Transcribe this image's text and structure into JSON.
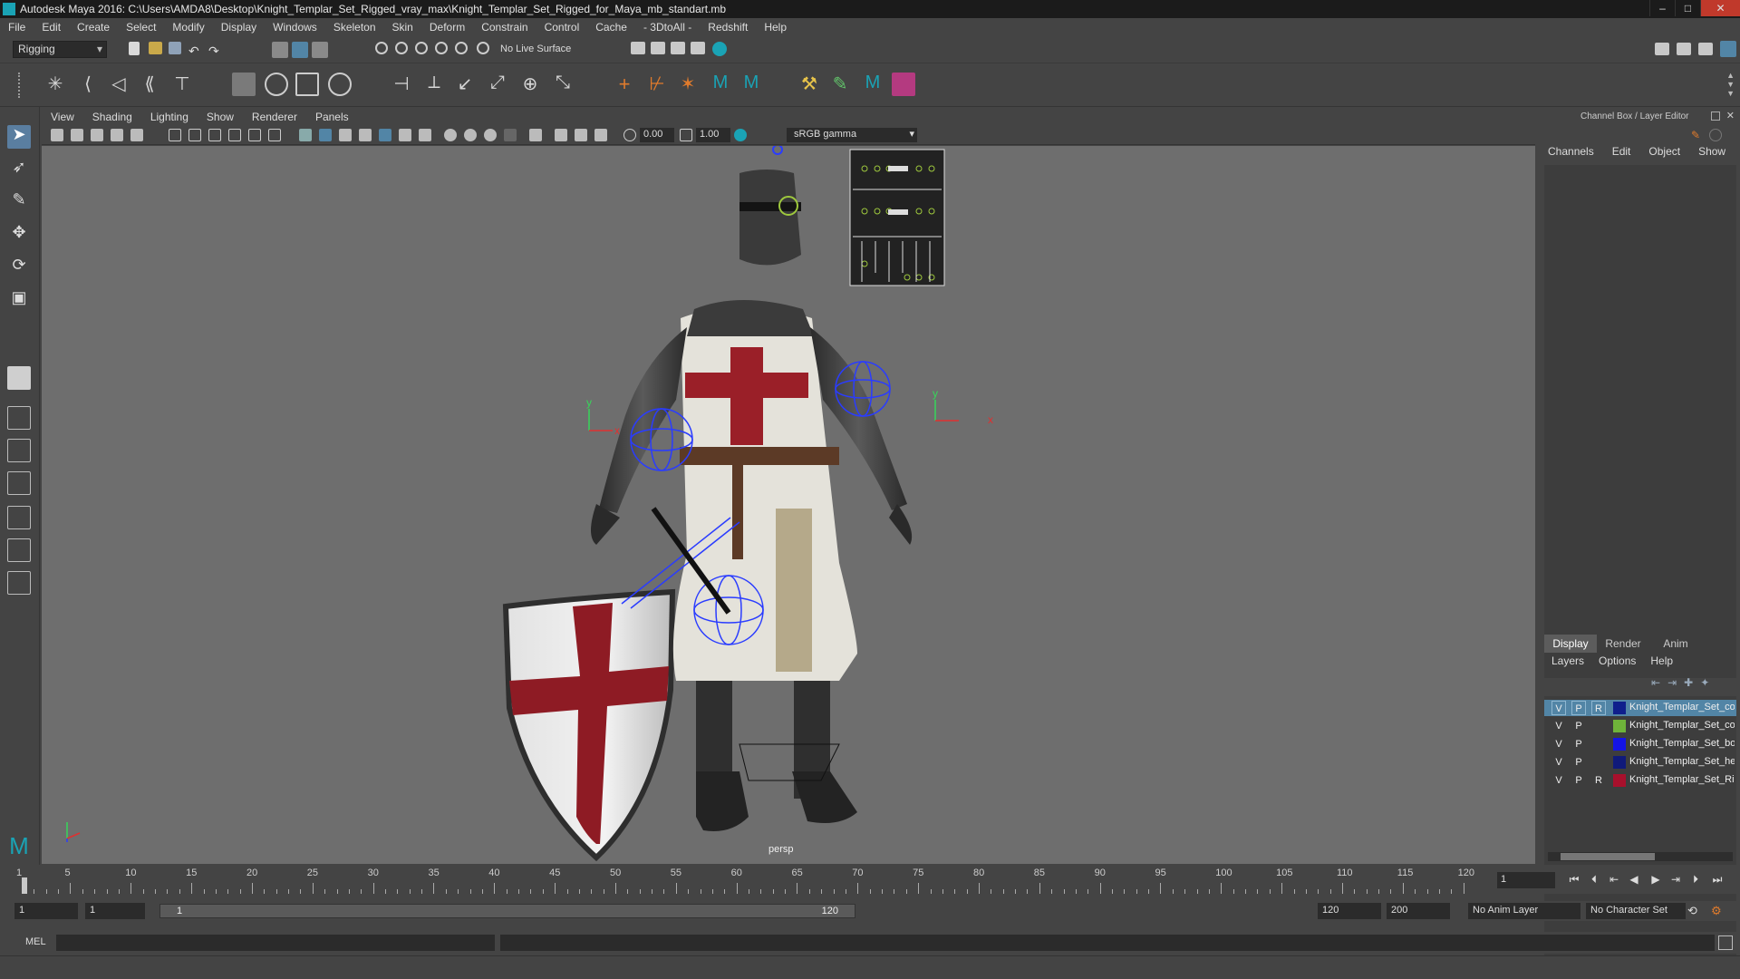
{
  "window": {
    "title": "Autodesk Maya 2016: C:\\Users\\AMDA8\\Desktop\\Knight_Templar_Set_Rigged_vray_max\\Knight_Templar_Set_Rigged_for_Maya_mb_standart.mb"
  },
  "menubar": [
    "File",
    "Edit",
    "Create",
    "Select",
    "Modify",
    "Display",
    "Windows",
    "Skeleton",
    "Skin",
    "Deform",
    "Constrain",
    "Control",
    "Cache",
    "- 3DtoAll -",
    "Redshift",
    "Help"
  ],
  "status_line": {
    "mode": "Rigging",
    "live_surface": "No Live Surface"
  },
  "viewport": {
    "menu": [
      "View",
      "Shading",
      "Lighting",
      "Show",
      "Renderer",
      "Panels"
    ],
    "exposure": "0.00",
    "gamma": "1.00",
    "color_space": "sRGB gamma",
    "camera": "persp"
  },
  "channel_box": {
    "title": "Channel Box / Layer Editor",
    "menu": [
      "Channels",
      "Edit",
      "Object",
      "Show"
    ]
  },
  "layer_editor": {
    "tabs": [
      "Display",
      "Render",
      "Anim"
    ],
    "active_tab": "Display",
    "menu": [
      "Layers",
      "Options",
      "Help"
    ],
    "layers": [
      {
        "v": "V",
        "p": "P",
        "r": "R",
        "name": "Knight_Templar_Set_co",
        "color": "#0f1f8c",
        "selected": true
      },
      {
        "v": "V",
        "p": "P",
        "r": "",
        "name": "Knight_Templar_Set_co",
        "color": "#6fb33a",
        "selected": false
      },
      {
        "v": "V",
        "p": "P",
        "r": "",
        "name": "Knight_Templar_Set_bo",
        "color": "#1414e6",
        "selected": false
      },
      {
        "v": "V",
        "p": "P",
        "r": "",
        "name": "Knight_Templar_Set_he",
        "color": "#101a7a",
        "selected": false
      },
      {
        "v": "V",
        "p": "P",
        "r": "R",
        "name": "Knight_Templar_Set_Ri",
        "color": "#a8102c",
        "selected": false
      }
    ]
  },
  "time_slider": {
    "ticks": [
      "1",
      "5",
      "10",
      "15",
      "20",
      "25",
      "30",
      "35",
      "40",
      "45",
      "50",
      "55",
      "60",
      "65",
      "70",
      "75",
      "80",
      "85",
      "90",
      "95",
      "100",
      "105",
      "110",
      "115",
      "120"
    ],
    "current_frame": "1"
  },
  "range_slider": {
    "start": "1",
    "playback_start": "1",
    "range_start_label": "1",
    "range_end_label": "120",
    "playback_end": "120",
    "end": "200",
    "anim_layer": "No Anim Layer",
    "character_set": "No Character Set"
  },
  "command_line": {
    "label": "MEL"
  },
  "colors": {
    "accent": "#5285a6",
    "viewport_bg": "#6e6e6e"
  }
}
